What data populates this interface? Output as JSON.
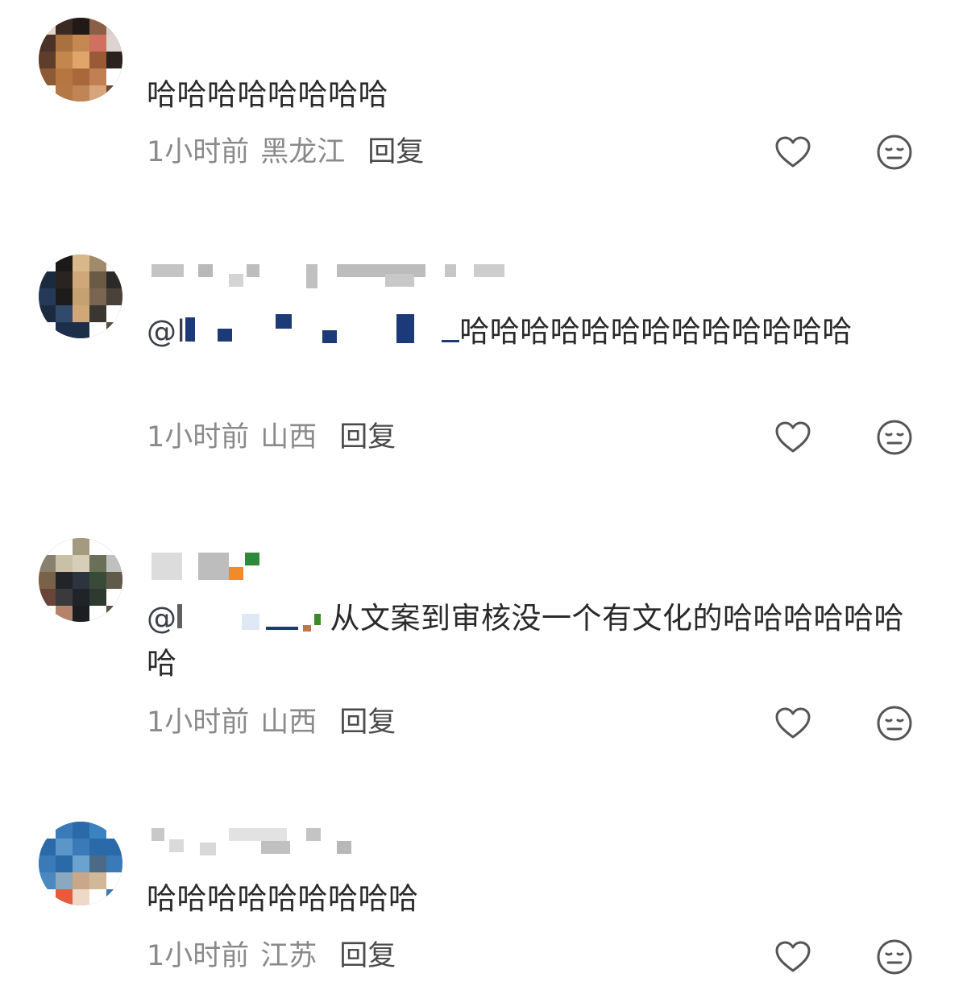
{
  "comments": [
    {
      "text": "哈哈哈哈哈哈哈哈",
      "time": "1小时前",
      "location": "黑龙江",
      "reply": "回复"
    },
    {
      "mention_prefix": "@l",
      "text": "哈哈哈哈哈哈哈哈哈哈哈哈哈",
      "time": "1小时前",
      "location": "山西",
      "reply": "回复"
    },
    {
      "mention_prefix": "@",
      "text": "从文案到审核没一个有文化的哈哈哈哈哈哈哈",
      "time": "1小时前",
      "location": "山西",
      "reply": "回复"
    },
    {
      "text": "哈哈哈哈哈哈哈哈哈",
      "time": "1小时前",
      "location": "江苏",
      "reply": "回复"
    }
  ],
  "icons": {
    "like": "heart-outline-icon",
    "dislike": "neutral-face-icon"
  },
  "colors": {
    "text": "#2a2a2a",
    "meta": "#8a8a8a",
    "reply": "#4a4a4a",
    "icon": "#555555"
  }
}
